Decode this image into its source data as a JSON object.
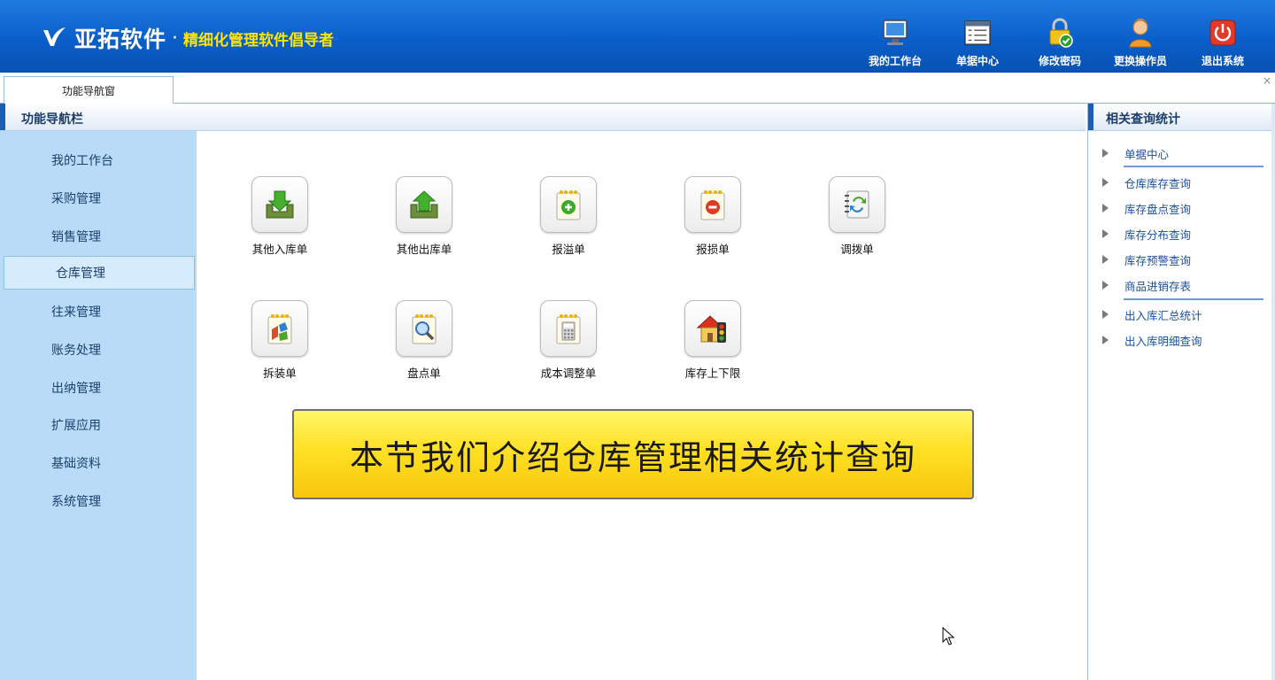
{
  "header": {
    "brand": "亚拓软件",
    "separator": "·",
    "slogan": "精细化管理软件倡导者",
    "buttons": [
      {
        "label": "我的工作台",
        "icon": "monitor-icon"
      },
      {
        "label": "单据中心",
        "icon": "document-list-icon"
      },
      {
        "label": "修改密码",
        "icon": "lock-icon"
      },
      {
        "label": "更换操作员",
        "icon": "user-icon"
      },
      {
        "label": "退出系统",
        "icon": "power-icon"
      }
    ]
  },
  "tabs": [
    {
      "label": "功能导航窗",
      "active": true
    }
  ],
  "close_glyph": "×",
  "nav": {
    "title": "功能导航栏",
    "items": [
      {
        "label": "我的工作台"
      },
      {
        "label": "采购管理"
      },
      {
        "label": "销售管理"
      },
      {
        "label": "仓库管理",
        "active": true
      },
      {
        "label": "往来管理"
      },
      {
        "label": "账务处理"
      },
      {
        "label": "出纳管理"
      },
      {
        "label": "扩展应用"
      },
      {
        "label": "基础资料"
      },
      {
        "label": "系统管理"
      }
    ]
  },
  "functions": [
    {
      "label": "其他入库单",
      "icon": "inbound-arrow-icon"
    },
    {
      "label": "其他出库单",
      "icon": "outbound-arrow-icon"
    },
    {
      "label": "报溢单",
      "icon": "notepad-plus-icon"
    },
    {
      "label": "报损单",
      "icon": "notepad-minus-icon"
    },
    {
      "label": "调拨单",
      "icon": "transfer-icon"
    },
    {
      "label": "拆装单",
      "icon": "assembly-icon"
    },
    {
      "label": "盘点单",
      "icon": "magnifier-icon"
    },
    {
      "label": "成本调整单",
      "icon": "calculator-icon"
    },
    {
      "label": "库存上下限",
      "icon": "house-traffic-light-icon"
    }
  ],
  "banner": {
    "text": "本节我们介绍仓库管理相关统计查询"
  },
  "related": {
    "title": "相关查询统计",
    "items": [
      {
        "label": "单据中心"
      },
      {
        "label": "仓库库存查询"
      },
      {
        "label": "库存盘点查询"
      },
      {
        "label": "库存分布查询"
      },
      {
        "label": "库存预警查询"
      },
      {
        "label": "商品进销存表"
      },
      {
        "label": "出入库汇总统计"
      },
      {
        "label": "出入库明细查询"
      }
    ]
  },
  "colors": {
    "header": "#0a5ec9",
    "slogan": "#ffe600",
    "sidebar": "#b8dcf8",
    "banner": "#ffe024",
    "link": "#1a4f9c"
  }
}
